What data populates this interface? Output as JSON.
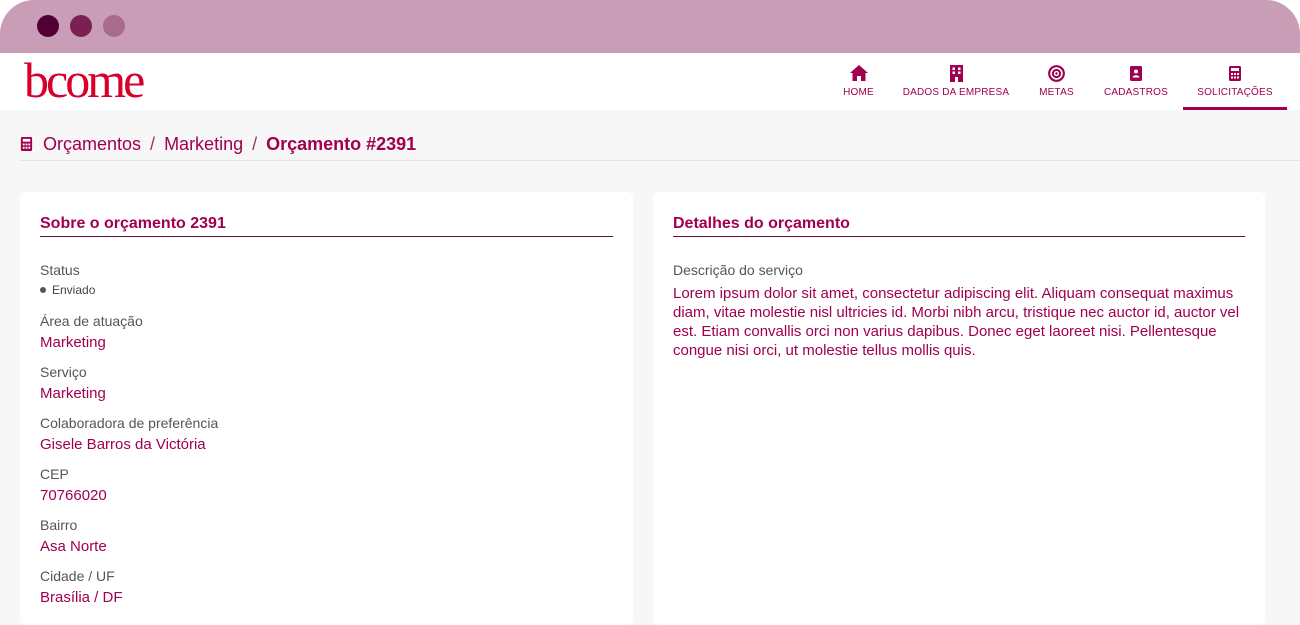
{
  "brand": {
    "logo_text": "bcome",
    "primary_color": "#a0004f",
    "logo_color": "#d6002a"
  },
  "nav": {
    "items": [
      {
        "label": "HOME",
        "icon": "home-icon"
      },
      {
        "label": "DADOS DA EMPRESA",
        "icon": "building-icon"
      },
      {
        "label": "METAS",
        "icon": "target-icon"
      },
      {
        "label": "CADASTROS",
        "icon": "contact-book-icon"
      },
      {
        "label": "SOLICITAÇÕES",
        "icon": "calculator-icon",
        "active": true
      }
    ]
  },
  "breadcrumb": {
    "icon": "calculator-icon",
    "items": [
      "Orçamentos",
      "Marketing",
      "Orçamento #2391"
    ],
    "separator": "/"
  },
  "about": {
    "title": "Sobre o orçamento 2391",
    "status": {
      "label": "Status",
      "value": "Enviado"
    },
    "fields": [
      {
        "label": "Área de atuação",
        "value": "Marketing"
      },
      {
        "label": "Serviço",
        "value": "Marketing"
      },
      {
        "label": "Colaboradora de preferência",
        "value": "Gisele Barros da Victória"
      },
      {
        "label": "CEP",
        "value": "70766020"
      },
      {
        "label": "Bairro",
        "value": "Asa Norte"
      },
      {
        "label": "Cidade / UF",
        "value": "Brasília / DF"
      }
    ]
  },
  "details": {
    "title": "Detalhes do orçamento",
    "description_label": "Descrição do serviço",
    "description": "Lorem ipsum dolor sit amet, consectetur adipiscing elit. Aliquam consequat maximus diam, vitae molestie nisl ultricies id. Morbi nibh arcu, tristique nec auctor id, auctor vel est. Etiam convallis orci non varius dapibus. Donec eget laoreet nisi. Pellentesque congue nisi orci, ut molestie tellus mollis quis."
  }
}
